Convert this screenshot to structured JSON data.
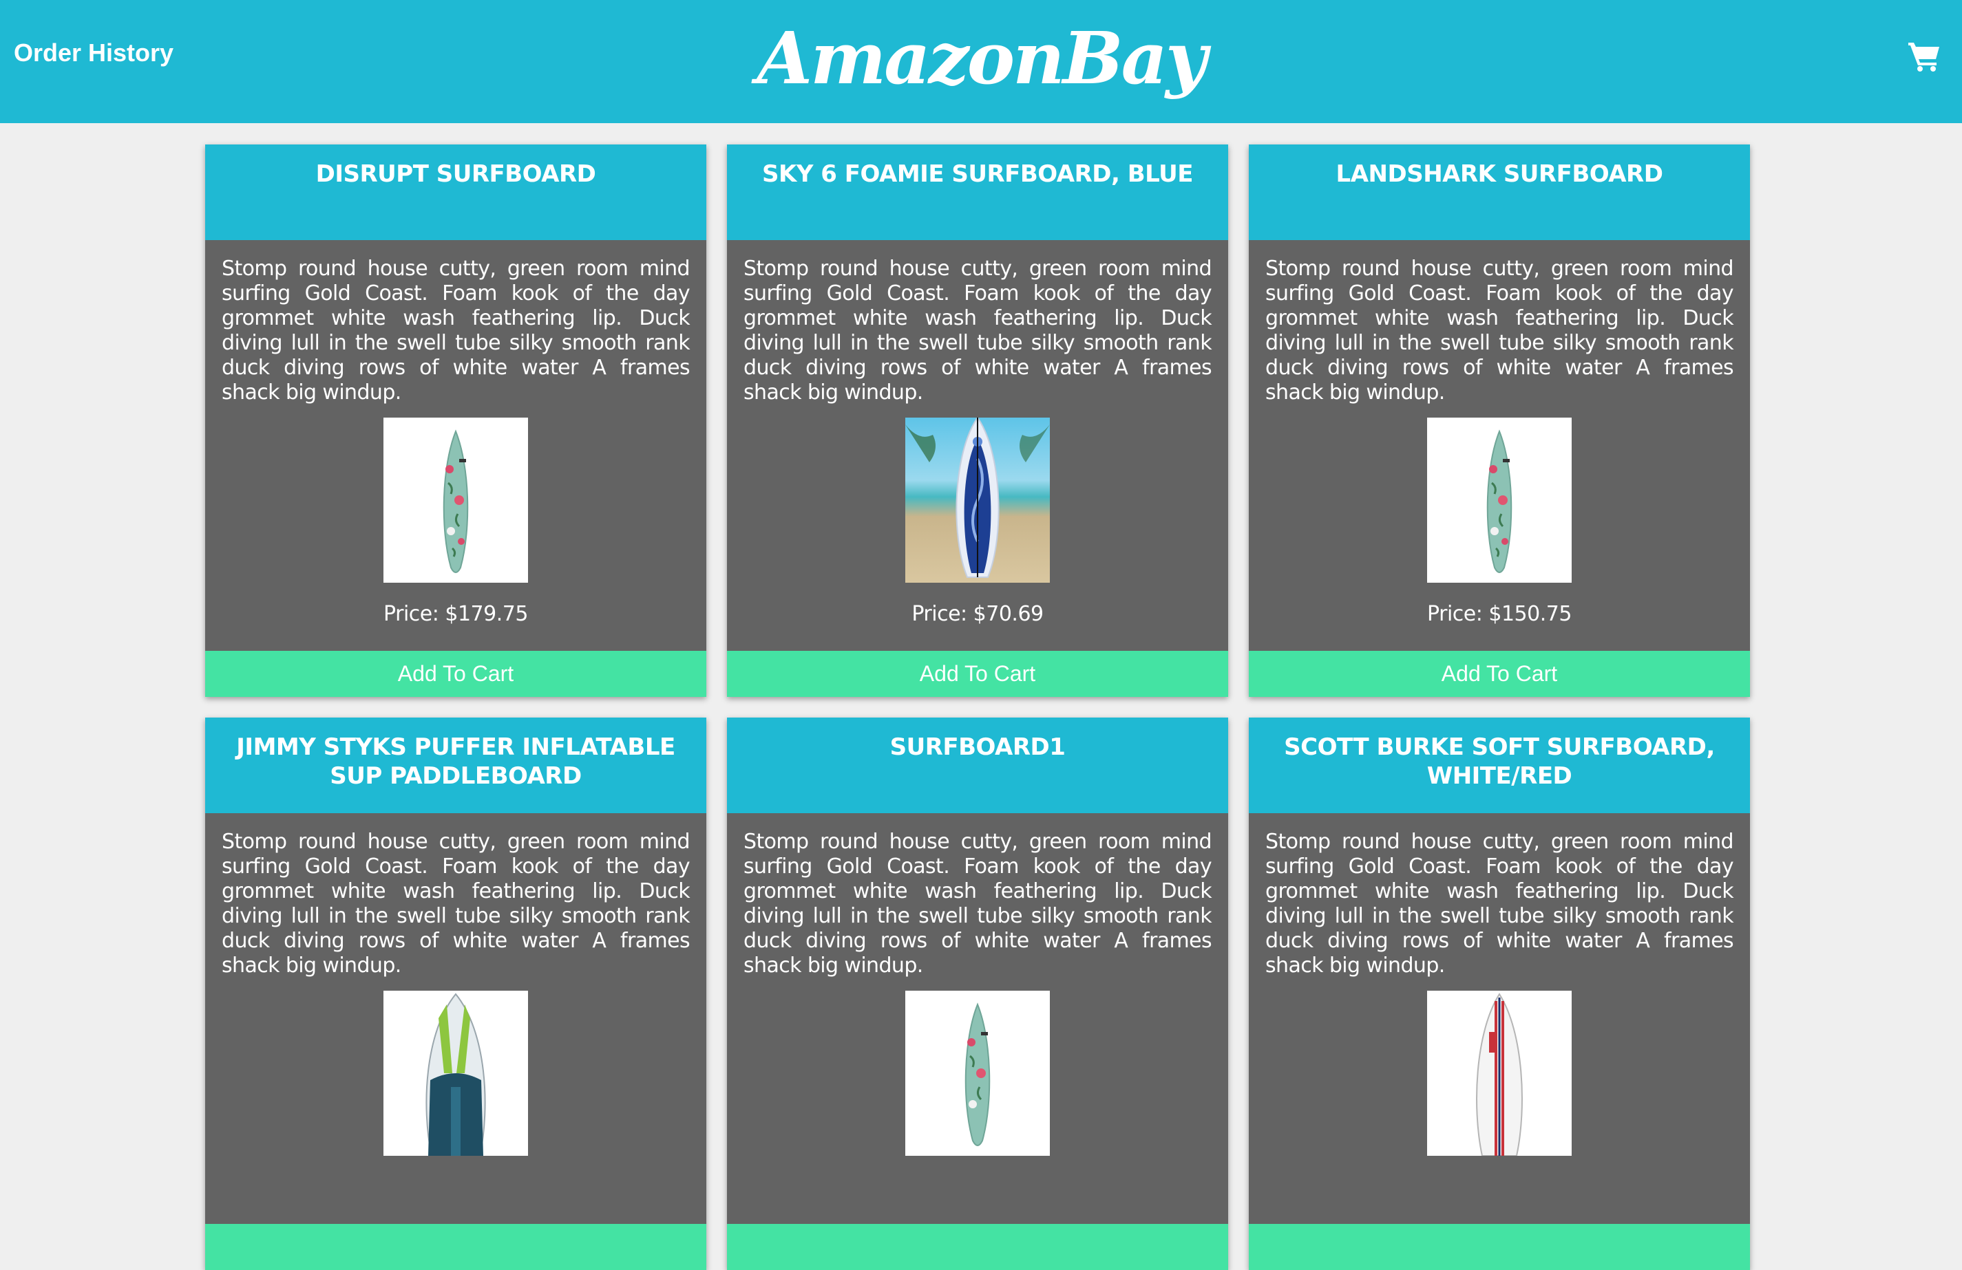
{
  "header": {
    "order_history_label": "Order History",
    "logo_text": "AmazonBay",
    "cart_icon": "shopping-cart-icon"
  },
  "colors": {
    "header_bg": "#1fb9d3",
    "card_bg": "#636363",
    "button_bg": "#44e3a3",
    "page_bg": "#efefef"
  },
  "products": [
    {
      "title": "DISRUPT SURFBOARD",
      "description": "Stomp round house cutty, green room mind surfing Gold Coast. Foam kook of the day grommet white wash feathering lip. Duck diving lull in the swell tube silky smooth rank duck diving rows of white water A frames shack big windup.",
      "price": "Price: $179.75",
      "button": "Add To Cart",
      "image": "floral-teal-surfboard"
    },
    {
      "title": "SKY 6 FOAMIE SURFBOARD, BLUE",
      "description": "Stomp round house cutty, green room mind surfing Gold Coast. Foam kook of the day grommet white wash feathering lip. Duck diving lull in the swell tube silky smooth rank duck diving rows of white water A frames shack big windup.",
      "price": "Price: $70.69",
      "button": "Add To Cart",
      "image": "blue-surfboard-on-beach"
    },
    {
      "title": "LANDSHARK SURFBOARD",
      "description": "Stomp round house cutty, green room mind surfing Gold Coast. Foam kook of the day grommet white wash feathering lip. Duck diving lull in the swell tube silky smooth rank duck diving rows of white water A frames shack big windup.",
      "price": "Price: $150.75",
      "button": "Add To Cart",
      "image": "floral-teal-surfboard"
    },
    {
      "title": "JIMMY STYKS PUFFER INFLATABLE SUP PADDLEBOARD",
      "description": "Stomp round house cutty, green room mind surfing Gold Coast. Foam kook of the day grommet white wash feathering lip. Duck diving lull in the swell tube silky smooth rank duck diving rows of white water A frames shack big windup.",
      "price": "",
      "button": "",
      "image": "green-navy-paddleboard"
    },
    {
      "title": "SURFBOARD1",
      "description": "Stomp round house cutty, green room mind surfing Gold Coast. Foam kook of the day grommet white wash feathering lip. Duck diving lull in the swell tube silky smooth rank duck diving rows of white water A frames shack big windup.",
      "price": "",
      "button": "",
      "image": "floral-teal-surfboard"
    },
    {
      "title": "SCOTT BURKE SOFT SURFBOARD, WHITE/RED",
      "description": "Stomp round house cutty, green room mind surfing Gold Coast. Foam kook of the day grommet white wash feathering lip. Duck diving lull in the swell tube silky smooth rank duck diving rows of white water A frames shack big windup.",
      "price": "",
      "button": "",
      "image": "white-red-surfboard"
    }
  ]
}
